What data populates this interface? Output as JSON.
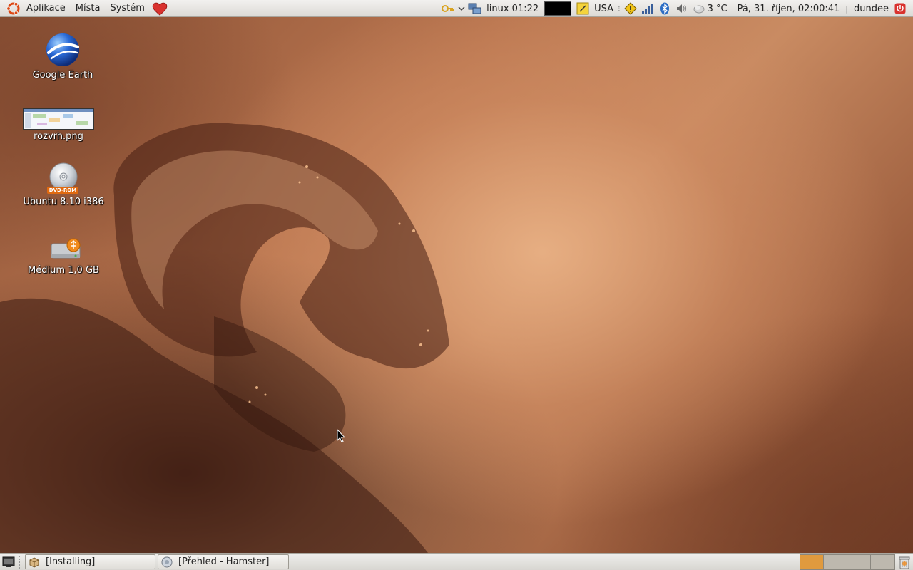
{
  "top_panel": {
    "menus": [
      "Aplikace",
      "Místa",
      "Systém"
    ],
    "workspace_label": "linux 01:22",
    "keyboard_layout": "USA",
    "weather": "3 °C",
    "datetime": "Pá, 31. říjen, 02:00:41",
    "user": "dundee"
  },
  "desktop": {
    "icons": [
      {
        "label": "Google Earth",
        "icon": "google-earth-icon"
      },
      {
        "label": "rozvrh.png",
        "icon": "image-thumbnail-icon"
      },
      {
        "label": "Ubuntu 8.10 i386",
        "icon": "dvd-rom-icon",
        "badge": "DVD-ROM"
      },
      {
        "label": "Médium 1,0 GB",
        "icon": "usb-drive-icon"
      }
    ]
  },
  "taskbar": {
    "tasks": [
      {
        "label": "[Installing]",
        "icon": "package-icon"
      },
      {
        "label": "[Přehled - Hamster]",
        "icon": "hamster-icon"
      }
    ],
    "workspaces": 4,
    "active_workspace": 1
  },
  "colors": {
    "panel": "#dcdad5",
    "workspace_active": "#e09a3e",
    "ubuntu_orange": "#dd4814"
  }
}
